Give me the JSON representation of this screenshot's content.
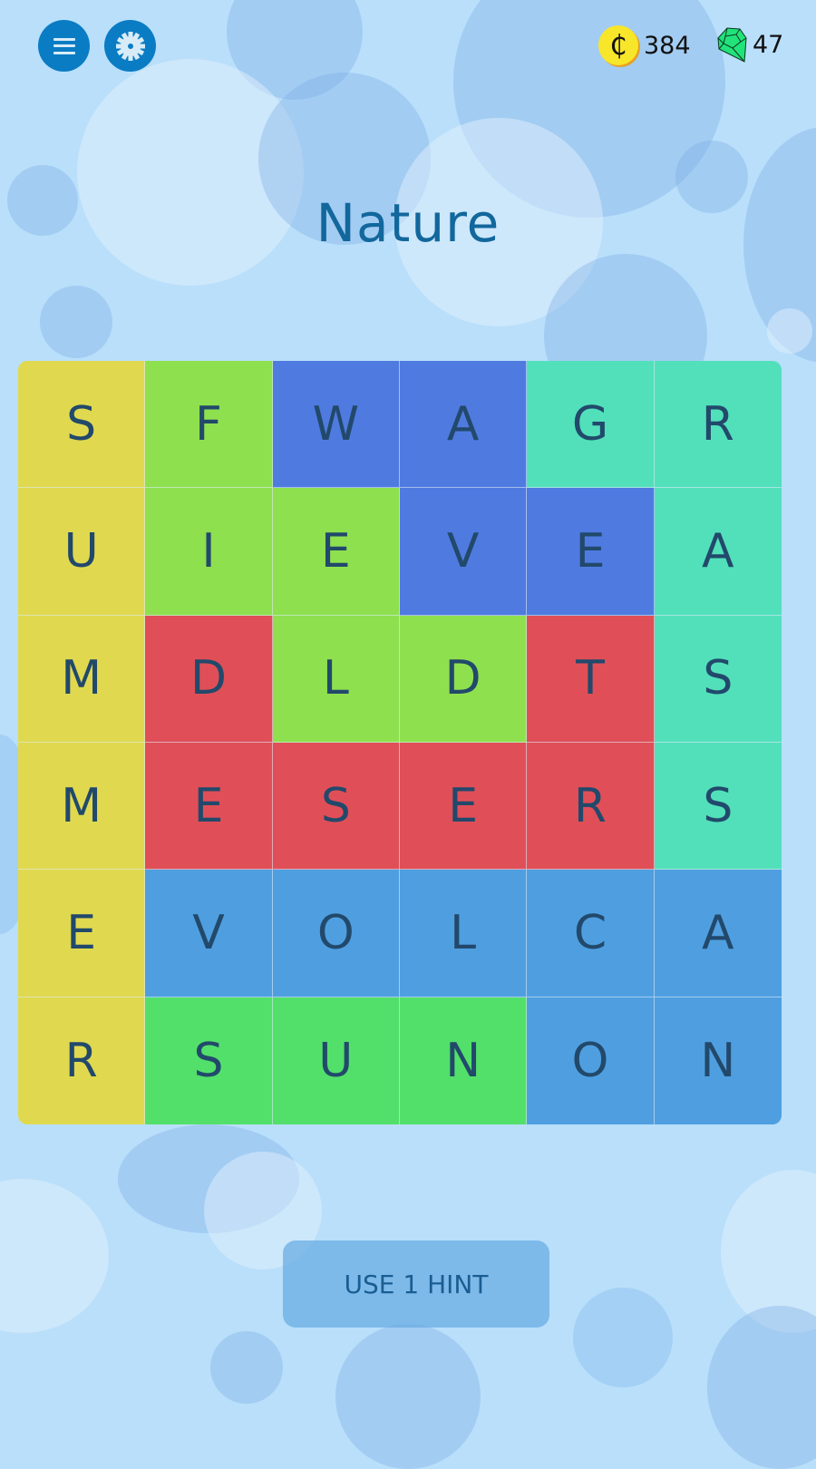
{
  "header": {
    "menu_icon": "hamburger-menu-icon",
    "settings_icon": "gear-icon",
    "coins": {
      "icon": "coin-icon",
      "symbol": "₵",
      "value": "384"
    },
    "gems": {
      "icon": "gem-icon",
      "value": "47"
    }
  },
  "puzzle": {
    "title": "Nature",
    "colors": {
      "yellow": "#e0d94f",
      "lime": "#8ee04f",
      "royal": "#4f7be0",
      "teal": "#52e0bb",
      "red": "#e04f57",
      "sky": "#4f9fe0",
      "green": "#52e06a"
    },
    "grid": [
      [
        {
          "letter": "S",
          "color": "yellow"
        },
        {
          "letter": "F",
          "color": "lime"
        },
        {
          "letter": "W",
          "color": "royal"
        },
        {
          "letter": "A",
          "color": "royal"
        },
        {
          "letter": "G",
          "color": "teal"
        },
        {
          "letter": "R",
          "color": "teal"
        }
      ],
      [
        {
          "letter": "U",
          "color": "yellow"
        },
        {
          "letter": "I",
          "color": "lime"
        },
        {
          "letter": "E",
          "color": "lime"
        },
        {
          "letter": "V",
          "color": "royal"
        },
        {
          "letter": "E",
          "color": "royal"
        },
        {
          "letter": "A",
          "color": "teal"
        }
      ],
      [
        {
          "letter": "M",
          "color": "yellow"
        },
        {
          "letter": "D",
          "color": "red"
        },
        {
          "letter": "L",
          "color": "lime"
        },
        {
          "letter": "D",
          "color": "lime"
        },
        {
          "letter": "T",
          "color": "red"
        },
        {
          "letter": "S",
          "color": "teal"
        }
      ],
      [
        {
          "letter": "M",
          "color": "yellow"
        },
        {
          "letter": "E",
          "color": "red"
        },
        {
          "letter": "S",
          "color": "red"
        },
        {
          "letter": "E",
          "color": "red"
        },
        {
          "letter": "R",
          "color": "red"
        },
        {
          "letter": "S",
          "color": "teal"
        }
      ],
      [
        {
          "letter": "E",
          "color": "yellow"
        },
        {
          "letter": "V",
          "color": "sky"
        },
        {
          "letter": "O",
          "color": "sky"
        },
        {
          "letter": "L",
          "color": "sky"
        },
        {
          "letter": "C",
          "color": "sky"
        },
        {
          "letter": "A",
          "color": "sky"
        }
      ],
      [
        {
          "letter": "R",
          "color": "yellow"
        },
        {
          "letter": "S",
          "color": "green"
        },
        {
          "letter": "U",
          "color": "green"
        },
        {
          "letter": "N",
          "color": "green"
        },
        {
          "letter": "O",
          "color": "sky"
        },
        {
          "letter": "N",
          "color": "sky"
        }
      ]
    ]
  },
  "hint_button": {
    "label": "USE 1 HINT"
  }
}
